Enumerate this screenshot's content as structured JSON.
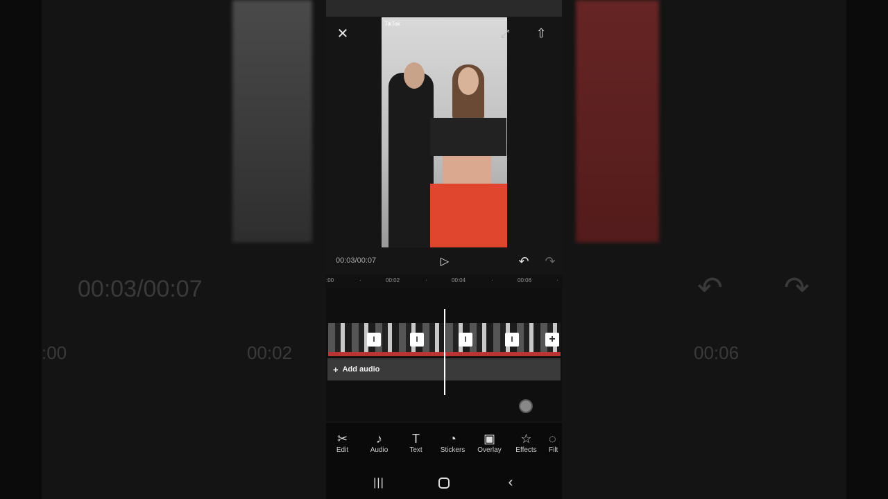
{
  "background": {
    "time": "00:03/00:07",
    "ruler_left": ":00",
    "ruler_mid": "00:02",
    "ruler_right": "00:06"
  },
  "preview": {
    "watermark": "TikTok"
  },
  "controls": {
    "time": "00:03/00:07"
  },
  "ruler": {
    "ticks": [
      ":00",
      "00:02",
      "00:04",
      "00:06"
    ]
  },
  "timeline": {
    "add_audio": "Add audio"
  },
  "toolbar": {
    "items": [
      {
        "label": "Edit",
        "icon": "scissors-icon",
        "glyph": "✂"
      },
      {
        "label": "Audio",
        "icon": "music-note-icon",
        "glyph": "♪"
      },
      {
        "label": "Text",
        "icon": "text-icon",
        "glyph": "T"
      },
      {
        "label": "Stickers",
        "icon": "sticker-icon",
        "glyph": "◔"
      },
      {
        "label": "Overlay",
        "icon": "overlay-icon",
        "glyph": "▣"
      },
      {
        "label": "Effects",
        "icon": "effects-star-icon",
        "glyph": "☆"
      },
      {
        "label": "Filt",
        "icon": "filter-icon",
        "glyph": "◌"
      }
    ]
  },
  "colors": {
    "background": "#151515",
    "accent": "#ffffff",
    "audio_track": "#3a3a3a"
  }
}
